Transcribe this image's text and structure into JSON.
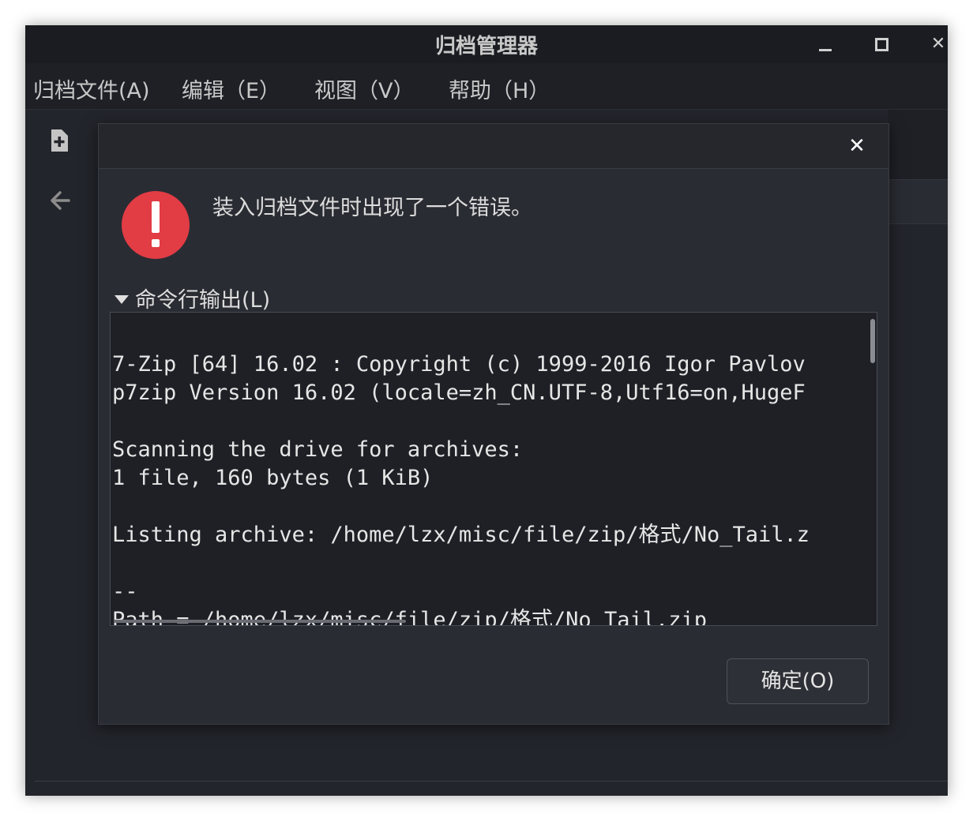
{
  "window": {
    "title": "归档管理器"
  },
  "menubar": {
    "items": [
      {
        "label": "归档文件(A)"
      },
      {
        "label": "编辑（E）"
      },
      {
        "label": "视图（V）"
      },
      {
        "label": "帮助（H）"
      }
    ]
  },
  "dialog": {
    "message": "装入归档文件时出现了一个错误。",
    "expander_label": "命令行输出(L)",
    "output_lines": [
      "",
      "7-Zip [64] 16.02 : Copyright (c) 1999-2016 Igor Pavlov",
      "p7zip Version 16.02 (locale=zh_CN.UTF-8,Utf16=on,HugeF",
      "",
      "Scanning the drive for archives:",
      "1 file, 160 bytes (1 KiB)",
      "",
      "Listing archive: /home/lzx/misc/file/zip/格式/No_Tail.z",
      "",
      "--",
      "Path = /home/lzx/misc/file/zip/格式/No_Tail.zip"
    ],
    "ok_label": "确定(O)"
  },
  "colors": {
    "error_red": "#e23c44",
    "window_bg": "#23252c",
    "dialog_bg": "#2a2c33"
  },
  "icons": {
    "new_file": "document-add-icon",
    "back": "arrow-left-icon",
    "error": "error-exclamation-icon",
    "close": "close-icon"
  }
}
